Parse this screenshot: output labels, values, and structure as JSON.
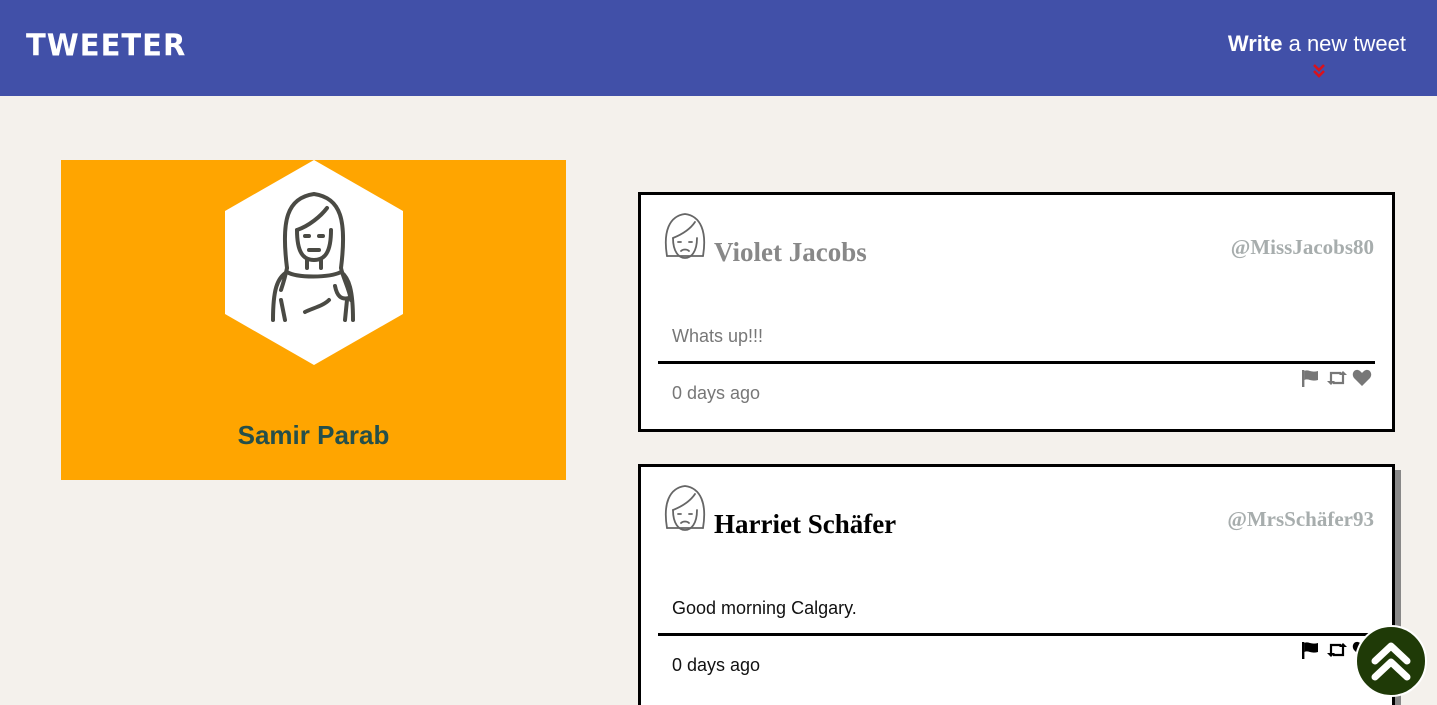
{
  "app": {
    "logo": "TWEETER",
    "compose_bold": "Write",
    "compose_rest": " a new tweet",
    "compose_arrow": "»"
  },
  "profile": {
    "name": "Samir Parab"
  },
  "tweets": [
    {
      "name": "Violet Jacobs",
      "handle": "@MissJacobs80",
      "content": "Whats up!!!",
      "time": "0 days ago"
    },
    {
      "name": "Harriet Schäfer",
      "handle": "@MrsSchäfer93",
      "content": "Good morning Calgary.",
      "time": "0 days ago"
    }
  ],
  "colors": {
    "nav": "#4150a8",
    "profile_bg": "#ffa500",
    "profile_name": "#254f4a",
    "page_bg": "#f4f1ec",
    "arrow_accent": "#d8121c",
    "scroll_button": "#1f3a07"
  },
  "icons": {
    "compose_arrow": "double-chevron-down-icon",
    "flag": "flag-icon",
    "retweet": "retweet-icon",
    "like": "heart-icon",
    "scroll_top": "double-chevron-up-icon"
  }
}
